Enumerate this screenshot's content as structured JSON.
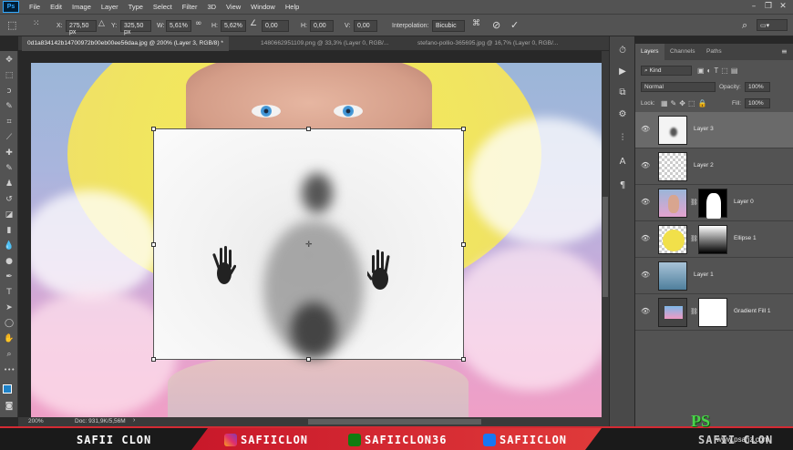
{
  "menubar": {
    "logo": "Ps",
    "items": [
      "File",
      "Edit",
      "Image",
      "Layer",
      "Type",
      "Select",
      "Filter",
      "3D",
      "View",
      "Window",
      "Help"
    ]
  },
  "options": {
    "x_label": "X:",
    "x_value": "275,50 px",
    "y_label": "Y:",
    "y_value": "325,50 px",
    "w_label": "W:",
    "w_value": "5,61%",
    "h_label": "H:",
    "h_value": "5,62%",
    "angle_value": "0,00",
    "hskew_label": "H:",
    "hskew_value": "0,00",
    "vskew_label": "V:",
    "vskew_value": "0,00",
    "interp_label": "Interpolation:",
    "interp_value": "Bicubic"
  },
  "tabs": [
    "0d1a834142b14700972b00eb00ee56daa.jpg @ 200% (Layer 3, RGB/8) *",
    "1480662951109.png @ 33,3% (Layer 0, RGB/...",
    "stefano-pollio-365695.jpg @ 16,7% (Layer 0, RGB/..."
  ],
  "status": {
    "zoom": "200%",
    "doc": "Doc: 931,9K/5,56M"
  },
  "panel": {
    "tabs": [
      "Layers",
      "Channels",
      "Paths"
    ],
    "kind": "Kind",
    "blend_mode": "Normal",
    "opacity_label": "Opacity:",
    "opacity_value": "100%",
    "lock_label": "Lock:",
    "fill_label": "Fill:",
    "fill_value": "100%",
    "layers": [
      {
        "name": "Layer 3",
        "selected": true
      },
      {
        "name": "Layer 2",
        "selected": false
      },
      {
        "name": "Layer 0",
        "selected": false
      },
      {
        "name": "Ellipse 1",
        "selected": false
      },
      {
        "name": "Layer 1",
        "selected": false
      },
      {
        "name": "Gradient Fill 1",
        "selected": false
      }
    ]
  },
  "banner": {
    "left": "SAFII CLON",
    "instagram": "SAFIICLON",
    "xbox": "SAFIICLON36",
    "facebook": "SAFIICLON",
    "right_partial": "SAFII CLON"
  },
  "watermark": {
    "mark": "PS",
    "site": "www.psahz.com"
  },
  "colors": {
    "accent": "#31a8ff",
    "banner_red": "#d42a33",
    "foreground": "#1e82c8"
  }
}
